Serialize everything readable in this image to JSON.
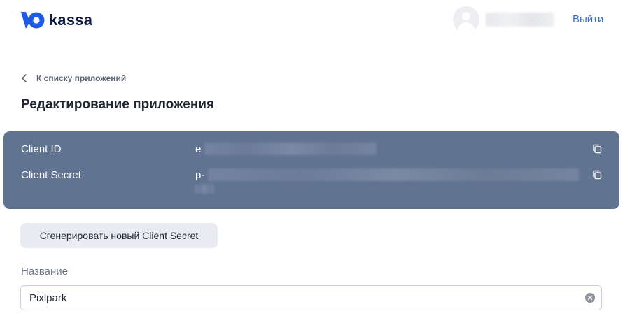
{
  "header": {
    "brand": "kassa",
    "logout_label": "Выйти"
  },
  "breadcrumb": {
    "label": "К списку приложений"
  },
  "page": {
    "title": "Редактирование приложения"
  },
  "credentials": {
    "client_id": {
      "label": "Client ID",
      "value": "e"
    },
    "client_secret": {
      "label": "Client Secret",
      "value": "p-"
    }
  },
  "actions": {
    "regenerate_label": "Сгенерировать новый Client Secret"
  },
  "form": {
    "name_label": "Название",
    "name_value": "Pixlpark"
  },
  "icons": {
    "logo": "yookassa-logo-icon",
    "back": "chevron-left-icon",
    "copy": "copy-icon",
    "clear": "clear-icon",
    "avatar": "user-avatar-icon"
  },
  "colors": {
    "brand": "#0b1a4b",
    "link": "#2f6fd6",
    "panel": "#607390",
    "button_bg": "#e8ebf1"
  }
}
